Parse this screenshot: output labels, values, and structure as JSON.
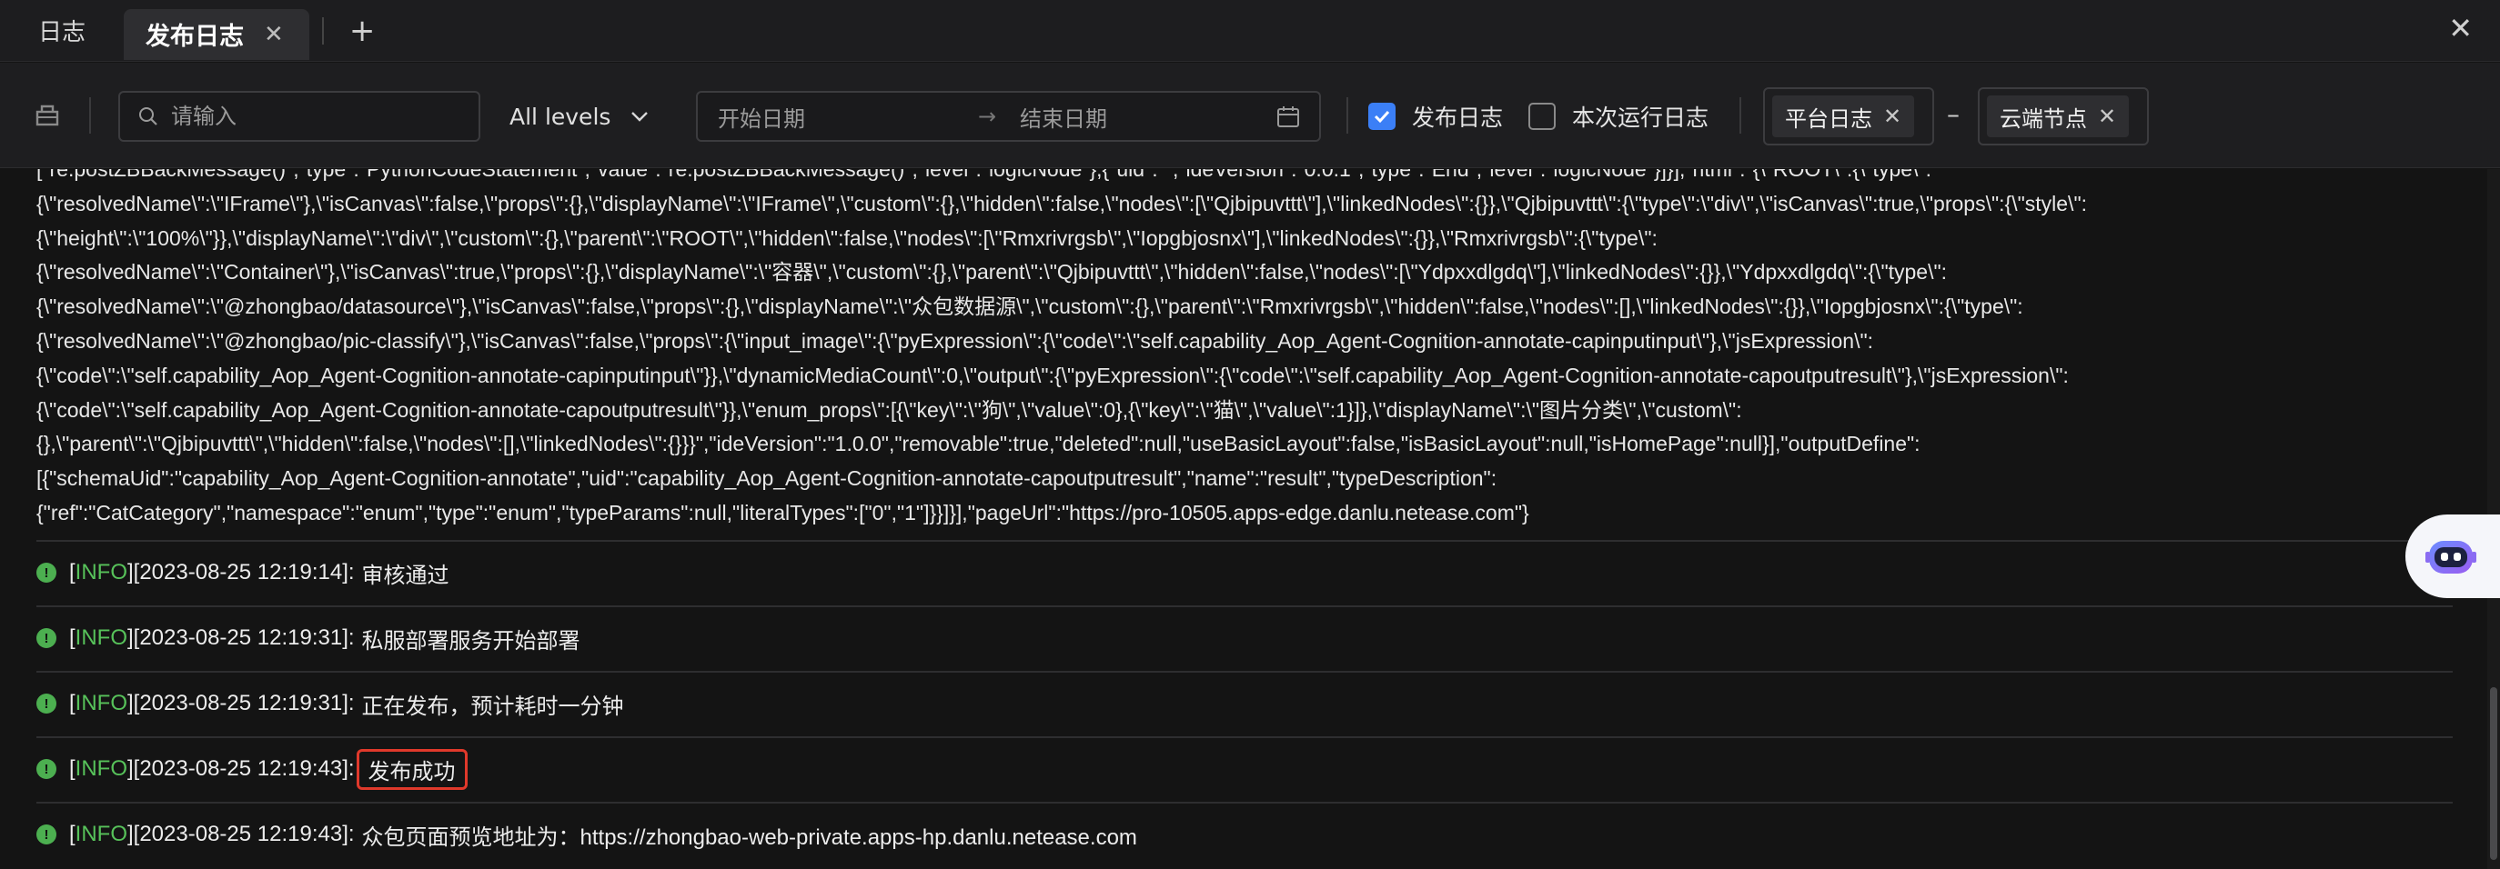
{
  "tabs": {
    "logs_label": "日志",
    "publish_label": "发布日志",
    "close_glyph": "✕",
    "add_glyph": "+"
  },
  "window": {
    "close_glyph": "✕"
  },
  "toolbar": {
    "search_placeholder": "请输入",
    "level_value": "All levels",
    "date_start_placeholder": "开始日期",
    "date_arrow": "→",
    "date_end_placeholder": "结束日期",
    "checkbox_publish_label": "发布日志",
    "checkbox_publish_checked": true,
    "checkbox_run_label": "本次运行日志",
    "checkbox_run_checked": false,
    "tag_platform": "平台日志",
    "tag_dash": "–",
    "tag_cloud": "云端节点",
    "tag_close_glyph": "✕"
  },
  "json_lines": [
    "[\"re.postZBBackMessage()\",\"type\":\"PythonCodeStatement\",\"value\":\"re.postZBBackMessage()\",\"level\":\"logicNode\"},{\"uid\":\"\",\"ideVersion\":\"0.0.1\",\"type\":\"End\",\"level\":\"logicNode\"}]}],\"html\":\"{\\\"ROOT\\\":{\\\"type\\\":",
    "{\\\"resolvedName\\\":\\\"IFrame\\\"},\\\"isCanvas\\\":false,\\\"props\\\":{},\\\"displayName\\\":\\\"IFrame\\\",\\\"custom\\\":{},\\\"hidden\\\":false,\\\"nodes\\\":[\\\"Qjbipuvttt\\\"],\\\"linkedNodes\\\":{}},\\\"Qjbipuvttt\\\":{\\\"type\\\":\\\"div\\\",\\\"isCanvas\\\":true,\\\"props\\\":{\\\"style\\\":",
    "{\\\"height\\\":\\\"100%\\\"}},\\\"displayName\\\":\\\"div\\\",\\\"custom\\\":{},\\\"parent\\\":\\\"ROOT\\\",\\\"hidden\\\":false,\\\"nodes\\\":[\\\"Rmxrivrgsb\\\",\\\"Iopgbjosnx\\\"],\\\"linkedNodes\\\":{}},\\\"Rmxrivrgsb\\\":{\\\"type\\\":",
    "{\\\"resolvedName\\\":\\\"Container\\\"},\\\"isCanvas\\\":true,\\\"props\\\":{},\\\"displayName\\\":\\\"容器\\\",\\\"custom\\\":{},\\\"parent\\\":\\\"Qjbipuvttt\\\",\\\"hidden\\\":false,\\\"nodes\\\":[\\\"Ydpxxdlgdq\\\"],\\\"linkedNodes\\\":{}},\\\"Ydpxxdlgdq\\\":{\\\"type\\\":",
    "{\\\"resolvedName\\\":\\\"@zhongbao/datasource\\\"},\\\"isCanvas\\\":false,\\\"props\\\":{},\\\"displayName\\\":\\\"众包数据源\\\",\\\"custom\\\":{},\\\"parent\\\":\\\"Rmxrivrgsb\\\",\\\"hidden\\\":false,\\\"nodes\\\":[],\\\"linkedNodes\\\":{}},\\\"Iopgbjosnx\\\":{\\\"type\\\":",
    "{\\\"resolvedName\\\":\\\"@zhongbao/pic-classify\\\"},\\\"isCanvas\\\":false,\\\"props\\\":{\\\"input_image\\\":{\\\"pyExpression\\\":{\\\"code\\\":\\\"self.capability_Aop_Agent-Cognition-annotate-capinputinput\\\"},\\\"jsExpression\\\":",
    "{\\\"code\\\":\\\"self.capability_Aop_Agent-Cognition-annotate-capinputinput\\\"}},\\\"dynamicMediaCount\\\":0,\\\"output\\\":{\\\"pyExpression\\\":{\\\"code\\\":\\\"self.capability_Aop_Agent-Cognition-annotate-capoutputresult\\\"},\\\"jsExpression\\\":",
    "{\\\"code\\\":\\\"self.capability_Aop_Agent-Cognition-annotate-capoutputresult\\\"}},\\\"enum_props\\\":[{\\\"key\\\":\\\"狗\\\",\\\"value\\\":0},{\\\"key\\\":\\\"猫\\\",\\\"value\\\":1}]},\\\"displayName\\\":\\\"图片分类\\\",\\\"custom\\\":",
    "{},\\\"parent\\\":\\\"Qjbipuvttt\\\",\\\"hidden\\\":false,\\\"nodes\\\":[],\\\"linkedNodes\\\":{}}}\",\"ideVersion\":\"1.0.0\",\"removable\":true,\"deleted\":null,\"useBasicLayout\":false,\"isBasicLayout\":null,\"isHomePage\":null}],\"outputDefine\":",
    "[{\"schemaUid\":\"capability_Aop_Agent-Cognition-annotate\",\"uid\":\"capability_Aop_Agent-Cognition-annotate-capoutputresult\",\"name\":\"result\",\"typeDescription\":",
    "{\"ref\":\"CatCategory\",\"namespace\":\"enum\",\"type\":\"enum\",\"typeParams\":null,\"literalTypes\":[\"0\",\"1\"]}}]}],\"pageUrl\":\"https://pro-10505.apps-edge.danlu.netease.com\"}"
  ],
  "log_entries": [
    {
      "open": "[",
      "level": "INFO",
      "stamp": "][2023-08-25 12:19:14]:",
      "message": "审核通过"
    },
    {
      "open": "[",
      "level": "INFO",
      "stamp": "][2023-08-25 12:19:31]:",
      "message": "私服部署服务开始部署"
    },
    {
      "open": "[",
      "level": "INFO",
      "stamp": "][2023-08-25 12:19:31]:",
      "message": "正在发布，预计耗时一分钟"
    },
    {
      "open": "[",
      "level": "INFO",
      "stamp": "][2023-08-25 12:19:43]:",
      "message": "发布成功"
    },
    {
      "open": "[",
      "level": "INFO",
      "stamp": "][2023-08-25 12:19:43]:",
      "message": "众包页面预览地址为：https://zhongbao-web-private.apps-hp.danlu.netease.com"
    }
  ],
  "colors": {
    "accent": "#3b7ff6",
    "info_green": "#57c25a",
    "highlight_red": "#e0392b",
    "background": "#141414"
  },
  "icons": {
    "toolbar_left": "box-icon",
    "search": "search-icon",
    "level_chevron": "chevron-down-icon",
    "calendar": "calendar-icon",
    "check": "check-icon",
    "info": "info-circle-icon",
    "assistant": "robot-icon"
  }
}
